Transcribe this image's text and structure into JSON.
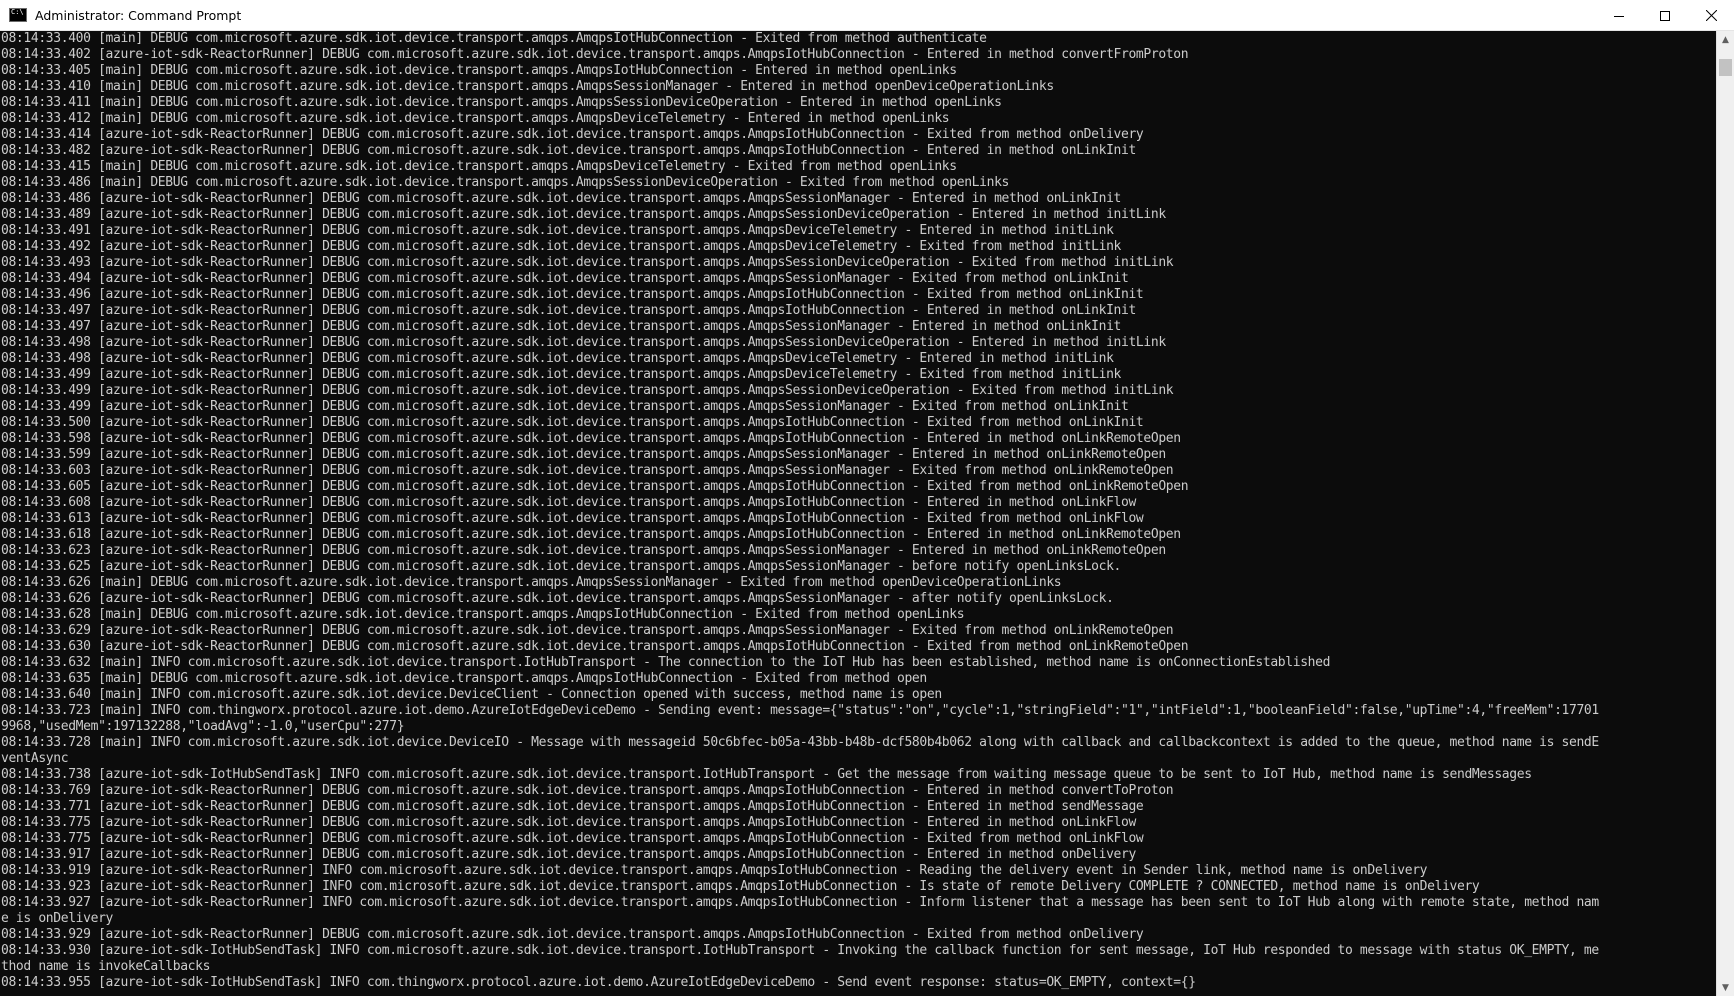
{
  "window": {
    "title": "Administrator: Command Prompt",
    "icons": {
      "app": "cmd-icon",
      "minimize": "minimize-icon",
      "maximize": "maximize-icon",
      "close": "close-icon"
    }
  },
  "console": {
    "background": "#0c0c0c",
    "foreground": "#cccccc",
    "lines": [
      "08:14:33.400 [main] DEBUG com.microsoft.azure.sdk.iot.device.transport.amqps.AmqpsIotHubConnection - Exited from method authenticate",
      "08:14:33.402 [azure-iot-sdk-ReactorRunner] DEBUG com.microsoft.azure.sdk.iot.device.transport.amqps.AmqpsIotHubConnection - Entered in method convertFromProton",
      "08:14:33.405 [main] DEBUG com.microsoft.azure.sdk.iot.device.transport.amqps.AmqpsIotHubConnection - Entered in method openLinks",
      "08:14:33.410 [main] DEBUG com.microsoft.azure.sdk.iot.device.transport.amqps.AmqpsSessionManager - Entered in method openDeviceOperationLinks",
      "08:14:33.411 [main] DEBUG com.microsoft.azure.sdk.iot.device.transport.amqps.AmqpsSessionDeviceOperation - Entered in method openLinks",
      "08:14:33.412 [main] DEBUG com.microsoft.azure.sdk.iot.device.transport.amqps.AmqpsDeviceTelemetry - Entered in method openLinks",
      "08:14:33.414 [azure-iot-sdk-ReactorRunner] DEBUG com.microsoft.azure.sdk.iot.device.transport.amqps.AmqpsIotHubConnection - Exited from method onDelivery",
      "08:14:33.482 [azure-iot-sdk-ReactorRunner] DEBUG com.microsoft.azure.sdk.iot.device.transport.amqps.AmqpsIotHubConnection - Entered in method onLinkInit",
      "08:14:33.415 [main] DEBUG com.microsoft.azure.sdk.iot.device.transport.amqps.AmqpsDeviceTelemetry - Exited from method openLinks",
      "08:14:33.486 [main] DEBUG com.microsoft.azure.sdk.iot.device.transport.amqps.AmqpsSessionDeviceOperation - Exited from method openLinks",
      "08:14:33.486 [azure-iot-sdk-ReactorRunner] DEBUG com.microsoft.azure.sdk.iot.device.transport.amqps.AmqpsSessionManager - Entered in method onLinkInit",
      "08:14:33.489 [azure-iot-sdk-ReactorRunner] DEBUG com.microsoft.azure.sdk.iot.device.transport.amqps.AmqpsSessionDeviceOperation - Entered in method initLink",
      "08:14:33.491 [azure-iot-sdk-ReactorRunner] DEBUG com.microsoft.azure.sdk.iot.device.transport.amqps.AmqpsDeviceTelemetry - Entered in method initLink",
      "08:14:33.492 [azure-iot-sdk-ReactorRunner] DEBUG com.microsoft.azure.sdk.iot.device.transport.amqps.AmqpsDeviceTelemetry - Exited from method initLink",
      "08:14:33.493 [azure-iot-sdk-ReactorRunner] DEBUG com.microsoft.azure.sdk.iot.device.transport.amqps.AmqpsSessionDeviceOperation - Exited from method initLink",
      "08:14:33.494 [azure-iot-sdk-ReactorRunner] DEBUG com.microsoft.azure.sdk.iot.device.transport.amqps.AmqpsSessionManager - Exited from method onLinkInit",
      "08:14:33.496 [azure-iot-sdk-ReactorRunner] DEBUG com.microsoft.azure.sdk.iot.device.transport.amqps.AmqpsIotHubConnection - Exited from method onLinkInit",
      "08:14:33.497 [azure-iot-sdk-ReactorRunner] DEBUG com.microsoft.azure.sdk.iot.device.transport.amqps.AmqpsIotHubConnection - Entered in method onLinkInit",
      "08:14:33.497 [azure-iot-sdk-ReactorRunner] DEBUG com.microsoft.azure.sdk.iot.device.transport.amqps.AmqpsSessionManager - Entered in method onLinkInit",
      "08:14:33.498 [azure-iot-sdk-ReactorRunner] DEBUG com.microsoft.azure.sdk.iot.device.transport.amqps.AmqpsSessionDeviceOperation - Entered in method initLink",
      "08:14:33.498 [azure-iot-sdk-ReactorRunner] DEBUG com.microsoft.azure.sdk.iot.device.transport.amqps.AmqpsDeviceTelemetry - Entered in method initLink",
      "08:14:33.499 [azure-iot-sdk-ReactorRunner] DEBUG com.microsoft.azure.sdk.iot.device.transport.amqps.AmqpsDeviceTelemetry - Exited from method initLink",
      "08:14:33.499 [azure-iot-sdk-ReactorRunner] DEBUG com.microsoft.azure.sdk.iot.device.transport.amqps.AmqpsSessionDeviceOperation - Exited from method initLink",
      "08:14:33.499 [azure-iot-sdk-ReactorRunner] DEBUG com.microsoft.azure.sdk.iot.device.transport.amqps.AmqpsSessionManager - Exited from method onLinkInit",
      "08:14:33.500 [azure-iot-sdk-ReactorRunner] DEBUG com.microsoft.azure.sdk.iot.device.transport.amqps.AmqpsIotHubConnection - Exited from method onLinkInit",
      "08:14:33.598 [azure-iot-sdk-ReactorRunner] DEBUG com.microsoft.azure.sdk.iot.device.transport.amqps.AmqpsIotHubConnection - Entered in method onLinkRemoteOpen",
      "08:14:33.599 [azure-iot-sdk-ReactorRunner] DEBUG com.microsoft.azure.sdk.iot.device.transport.amqps.AmqpsSessionManager - Entered in method onLinkRemoteOpen",
      "08:14:33.603 [azure-iot-sdk-ReactorRunner] DEBUG com.microsoft.azure.sdk.iot.device.transport.amqps.AmqpsSessionManager - Exited from method onLinkRemoteOpen",
      "08:14:33.605 [azure-iot-sdk-ReactorRunner] DEBUG com.microsoft.azure.sdk.iot.device.transport.amqps.AmqpsIotHubConnection - Exited from method onLinkRemoteOpen",
      "08:14:33.608 [azure-iot-sdk-ReactorRunner] DEBUG com.microsoft.azure.sdk.iot.device.transport.amqps.AmqpsIotHubConnection - Entered in method onLinkFlow",
      "08:14:33.613 [azure-iot-sdk-ReactorRunner] DEBUG com.microsoft.azure.sdk.iot.device.transport.amqps.AmqpsIotHubConnection - Exited from method onLinkFlow",
      "08:14:33.618 [azure-iot-sdk-ReactorRunner] DEBUG com.microsoft.azure.sdk.iot.device.transport.amqps.AmqpsIotHubConnection - Entered in method onLinkRemoteOpen",
      "08:14:33.623 [azure-iot-sdk-ReactorRunner] DEBUG com.microsoft.azure.sdk.iot.device.transport.amqps.AmqpsSessionManager - Entered in method onLinkRemoteOpen",
      "08:14:33.625 [azure-iot-sdk-ReactorRunner] DEBUG com.microsoft.azure.sdk.iot.device.transport.amqps.AmqpsSessionManager - before notify openLinksLock.",
      "08:14:33.626 [main] DEBUG com.microsoft.azure.sdk.iot.device.transport.amqps.AmqpsSessionManager - Exited from method openDeviceOperationLinks",
      "08:14:33.626 [azure-iot-sdk-ReactorRunner] DEBUG com.microsoft.azure.sdk.iot.device.transport.amqps.AmqpsSessionManager - after notify openLinksLock.",
      "08:14:33.628 [main] DEBUG com.microsoft.azure.sdk.iot.device.transport.amqps.AmqpsIotHubConnection - Exited from method openLinks",
      "08:14:33.629 [azure-iot-sdk-ReactorRunner] DEBUG com.microsoft.azure.sdk.iot.device.transport.amqps.AmqpsSessionManager - Exited from method onLinkRemoteOpen",
      "08:14:33.630 [azure-iot-sdk-ReactorRunner] DEBUG com.microsoft.azure.sdk.iot.device.transport.amqps.AmqpsIotHubConnection - Exited from method onLinkRemoteOpen",
      "08:14:33.632 [main] INFO com.microsoft.azure.sdk.iot.device.transport.IotHubTransport - The connection to the IoT Hub has been established, method name is onConnectionEstablished",
      "08:14:33.635 [main] DEBUG com.microsoft.azure.sdk.iot.device.transport.amqps.AmqpsIotHubConnection - Exited from method open",
      "08:14:33.640 [main] INFO com.microsoft.azure.sdk.iot.device.DeviceClient - Connection opened with success, method name is open",
      "08:14:33.723 [main] INFO com.thingworx.protocol.azure.iot.demo.AzureIotEdgeDeviceDemo - Sending event: message={\"status\":\"on\",\"cycle\":1,\"stringField\":\"1\",\"intField\":1,\"booleanField\":false,\"upTime\":4,\"freeMem\":17701",
      "9968,\"usedMem\":197132288,\"loadAvg\":-1.0,\"userCpu\":277}",
      "08:14:33.728 [main] INFO com.microsoft.azure.sdk.iot.device.DeviceIO - Message with messageid 50c6bfec-b05a-43bb-b48b-dcf580b4b062 along with callback and callbackcontext is added to the queue, method name is sendE",
      "ventAsync",
      "08:14:33.738 [azure-iot-sdk-IotHubSendTask] INFO com.microsoft.azure.sdk.iot.device.transport.IotHubTransport - Get the message from waiting message queue to be sent to IoT Hub, method name is sendMessages",
      "08:14:33.769 [azure-iot-sdk-ReactorRunner] DEBUG com.microsoft.azure.sdk.iot.device.transport.amqps.AmqpsIotHubConnection - Entered in method convertToProton",
      "08:14:33.771 [azure-iot-sdk-ReactorRunner] DEBUG com.microsoft.azure.sdk.iot.device.transport.amqps.AmqpsIotHubConnection - Entered in method sendMessage",
      "08:14:33.775 [azure-iot-sdk-ReactorRunner] DEBUG com.microsoft.azure.sdk.iot.device.transport.amqps.AmqpsIotHubConnection - Entered in method onLinkFlow",
      "08:14:33.775 [azure-iot-sdk-ReactorRunner] DEBUG com.microsoft.azure.sdk.iot.device.transport.amqps.AmqpsIotHubConnection - Exited from method onLinkFlow",
      "08:14:33.917 [azure-iot-sdk-ReactorRunner] DEBUG com.microsoft.azure.sdk.iot.device.transport.amqps.AmqpsIotHubConnection - Entered in method onDelivery",
      "08:14:33.919 [azure-iot-sdk-ReactorRunner] INFO com.microsoft.azure.sdk.iot.device.transport.amqps.AmqpsIotHubConnection - Reading the delivery event in Sender link, method name is onDelivery",
      "08:14:33.923 [azure-iot-sdk-ReactorRunner] INFO com.microsoft.azure.sdk.iot.device.transport.amqps.AmqpsIotHubConnection - Is state of remote Delivery COMPLETE ? CONNECTED, method name is onDelivery",
      "08:14:33.927 [azure-iot-sdk-ReactorRunner] INFO com.microsoft.azure.sdk.iot.device.transport.amqps.AmqpsIotHubConnection - Inform listener that a message has been sent to IoT Hub along with remote state, method nam",
      "e is onDelivery",
      "08:14:33.929 [azure-iot-sdk-ReactorRunner] DEBUG com.microsoft.azure.sdk.iot.device.transport.amqps.AmqpsIotHubConnection - Exited from method onDelivery",
      "08:14:33.930 [azure-iot-sdk-IotHubSendTask] INFO com.microsoft.azure.sdk.iot.device.transport.IotHubTransport - Invoking the callback function for sent message, IoT Hub responded to message with status OK_EMPTY, me",
      "thod name is invokeCallbacks",
      "08:14:33.955 [azure-iot-sdk-IotHubSendTask] INFO com.thingworx.protocol.azure.iot.demo.AzureIotEdgeDeviceDemo - Send event response: status=OK_EMPTY, context={}"
    ]
  }
}
